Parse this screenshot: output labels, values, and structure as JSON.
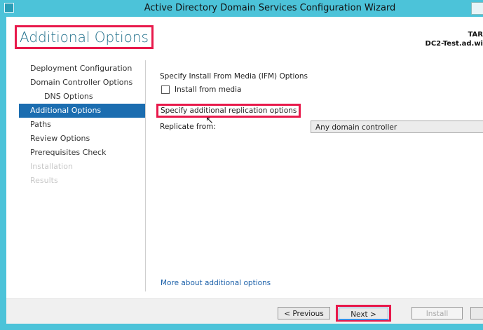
{
  "window": {
    "title": "Active Directory Domain Services Configuration Wizard"
  },
  "header": {
    "page_title": "Additional Options",
    "target_label": "TAR",
    "target_server": "DC2-Test.ad.wi"
  },
  "nav": {
    "items": [
      {
        "label": "Deployment Configuration",
        "state": "normal"
      },
      {
        "label": "Domain Controller Options",
        "state": "normal"
      },
      {
        "label": "DNS Options",
        "state": "sub"
      },
      {
        "label": "Additional Options",
        "state": "active"
      },
      {
        "label": "Paths",
        "state": "normal"
      },
      {
        "label": "Review Options",
        "state": "normal"
      },
      {
        "label": "Prerequisites Check",
        "state": "normal"
      },
      {
        "label": "Installation",
        "state": "disabled"
      },
      {
        "label": "Results",
        "state": "disabled"
      }
    ]
  },
  "main": {
    "ifm_heading": "Specify Install From Media (IFM) Options",
    "install_from_media_label": "Install from media",
    "install_from_media_checked": false,
    "replication_heading": "Specify additional replication options",
    "replicate_from_label": "Replicate from:",
    "replicate_from_value": "Any domain controller",
    "more_link": "More about additional options"
  },
  "footer": {
    "previous": "< Previous",
    "next": "Next >",
    "install": "Install"
  }
}
